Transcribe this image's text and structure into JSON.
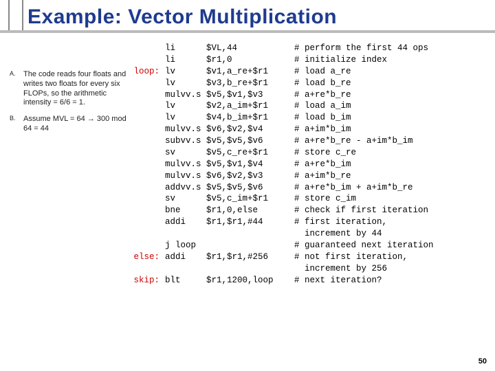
{
  "title": "Example: Vector Multiplication",
  "page_number": "50",
  "questions": [
    {
      "label": "A.",
      "text": "The code reads four floats and writes two floats for every six FLOPs, so the arithmetic intensity = 6/6 = 1."
    },
    {
      "label": "B.",
      "text": "Assume MVL = 64 → 300 mod 64 = 44"
    }
  ],
  "code": [
    {
      "label": "",
      "op": "li",
      "args": "$VL,44",
      "comment": "# perform the first 44 ops",
      "label_red": false
    },
    {
      "label": "",
      "op": "li",
      "args": "$r1,0",
      "comment": "# initialize index",
      "label_red": false
    },
    {
      "label": "loop:",
      "op": "lv",
      "args": "$v1,a_re+$r1",
      "comment": "# load a_re",
      "label_red": true
    },
    {
      "label": "",
      "op": "lv",
      "args": "$v3,b_re+$r1",
      "comment": "# load b_re",
      "label_red": false
    },
    {
      "label": "",
      "op": "mulvv.s",
      "args": "$v5,$v1,$v3",
      "comment": "# a+re*b_re",
      "label_red": false
    },
    {
      "label": "",
      "op": "lv",
      "args": "$v2,a_im+$r1",
      "comment": "# load a_im",
      "label_red": false
    },
    {
      "label": "",
      "op": "",
      "args": "",
      "comment": "",
      "label_red": false
    },
    {
      "label": "",
      "op": "lv",
      "args": "$v4,b_im+$r1",
      "comment": "# load b_im",
      "label_red": false
    },
    {
      "label": "",
      "op": "mulvv.s",
      "args": "$v6,$v2,$v4",
      "comment": "# a+im*b_im",
      "label_red": false
    },
    {
      "label": "",
      "op": "subvv.s",
      "args": "$v5,$v5,$v6",
      "comment": "# a+re*b_re - a+im*b_im",
      "label_red": false
    },
    {
      "label": "",
      "op": "sv",
      "args": "$v5,c_re+$r1",
      "comment": "# store c_re",
      "label_red": false
    },
    {
      "label": "",
      "op": "mulvv.s",
      "args": "$v5,$v1,$v4",
      "comment": "# a+re*b_im",
      "label_red": false
    },
    {
      "label": "",
      "op": "mulvv.s",
      "args": "$v6,$v2,$v3",
      "comment": "# a+im*b_re",
      "label_red": false
    },
    {
      "label": "",
      "op": "addvv.s",
      "args": "$v5,$v5,$v6",
      "comment": "# a+re*b_im + a+im*b_re",
      "label_red": false
    },
    {
      "label": "",
      "op": "sv",
      "args": "$v5,c_im+$r1",
      "comment": "# store c_im",
      "label_red": false
    },
    {
      "label": "",
      "op": "bne",
      "args": "$r1,0,else",
      "comment": "# check if first iteration",
      "label_red": false
    },
    {
      "label": "",
      "op": "addi",
      "args": "$r1,$r1,#44",
      "comment": "# first iteration,",
      "label_red": false
    },
    {
      "label": "",
      "op": "",
      "args": "",
      "comment": "  increment by 44",
      "label_red": false
    },
    {
      "label": "",
      "op": "j loop",
      "args": "",
      "comment": "# guaranteed next iteration",
      "label_red": false
    },
    {
      "label": "else:",
      "op": "addi",
      "args": "$r1,$r1,#256",
      "comment": "# not first iteration,",
      "label_red": true
    },
    {
      "label": "",
      "op": "",
      "args": "",
      "comment": "  increment by 256",
      "label_red": false
    },
    {
      "label": "skip:",
      "op": "blt",
      "args": "$r1,1200,loop",
      "comment": "# next iteration?",
      "label_red": true
    }
  ]
}
